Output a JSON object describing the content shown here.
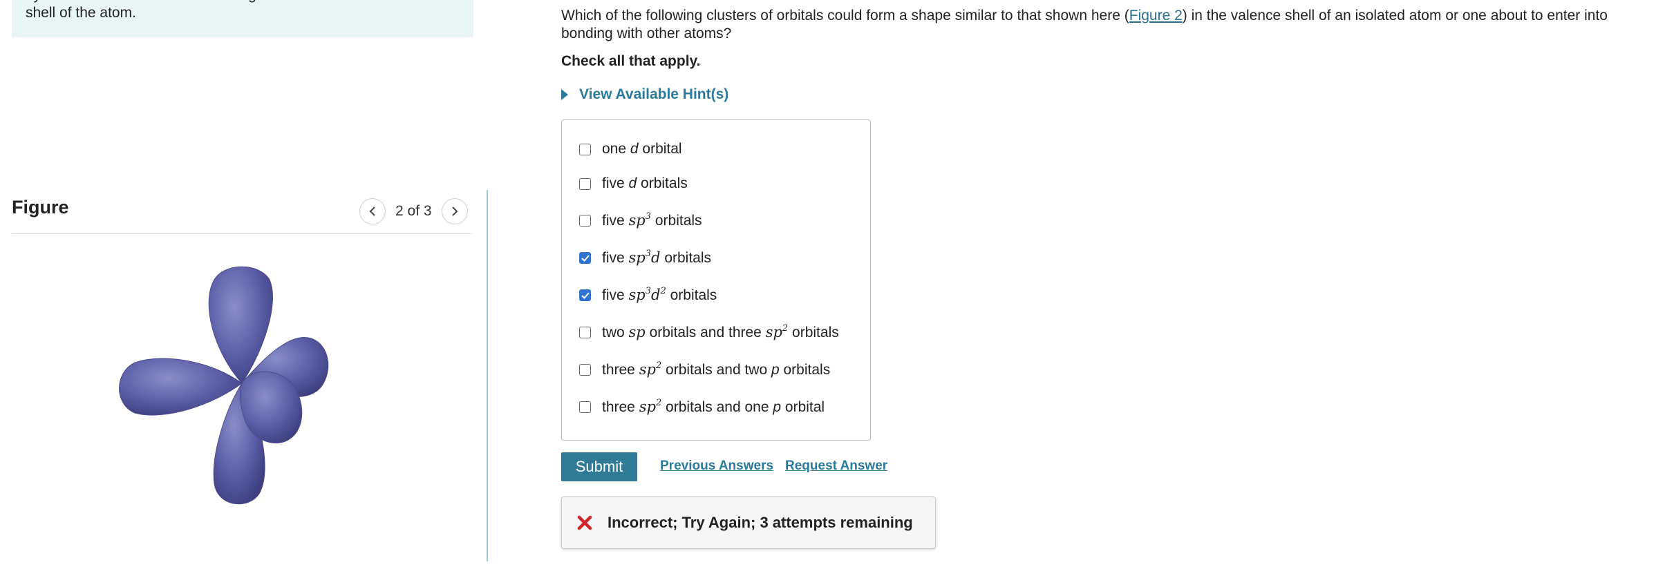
{
  "intro": {
    "cut_line": "hybridization still remain in their original orientation in the valence",
    "line2": "shell of the atom."
  },
  "figure": {
    "title": "Figure",
    "pager": "2 of 3",
    "prev_icon": "chevron-left-icon",
    "next_icon": "chevron-right-icon",
    "image_fill": "#5b5ea6"
  },
  "question": {
    "before_link": "Which of the following clusters of orbitals could form a shape similar to that shown here (",
    "link": "Figure 2",
    "after_link": ") in the valence shell of an isolated atom or one about to enter into bonding with other atoms?",
    "check_all": "Check all that apply."
  },
  "hints": {
    "label": "View Available Hint(s)"
  },
  "options": [
    {
      "parts": [
        "one ",
        "d",
        " orbital"
      ],
      "checked": false
    },
    {
      "parts": [
        "five ",
        "d",
        " orbitals"
      ],
      "checked": false
    },
    {
      "parts": [
        "five ",
        "sp",
        "3",
        " orbitals"
      ],
      "checked": false
    },
    {
      "parts": [
        "five ",
        "sp",
        "3",
        "d",
        " orbitals"
      ],
      "checked": true
    },
    {
      "parts": [
        "five ",
        "sp",
        "3",
        "d",
        "2",
        " orbitals"
      ],
      "checked": true
    },
    {
      "parts": [
        "two ",
        "sp",
        " orbitals and three ",
        "sp",
        "2",
        " orbitals"
      ],
      "checked": false
    },
    {
      "parts": [
        "three ",
        "sp",
        "2",
        " orbitals and two ",
        "p",
        " orbitals"
      ],
      "checked": false
    },
    {
      "parts": [
        "three ",
        "sp",
        "2",
        " orbitals and one ",
        "p",
        " orbital"
      ],
      "checked": false
    }
  ],
  "actions": {
    "submit": "Submit",
    "previous_answers": "Previous Answers",
    "request_answer": "Request Answer"
  },
  "feedback": {
    "icon": "x-mark-icon",
    "message": "Incorrect; Try Again; 3 attempts remaining",
    "color": "#d0232a"
  },
  "colors": {
    "accent": "#2f7a96",
    "link": "#2a7b9b",
    "checkbox": "#2f74d0"
  }
}
